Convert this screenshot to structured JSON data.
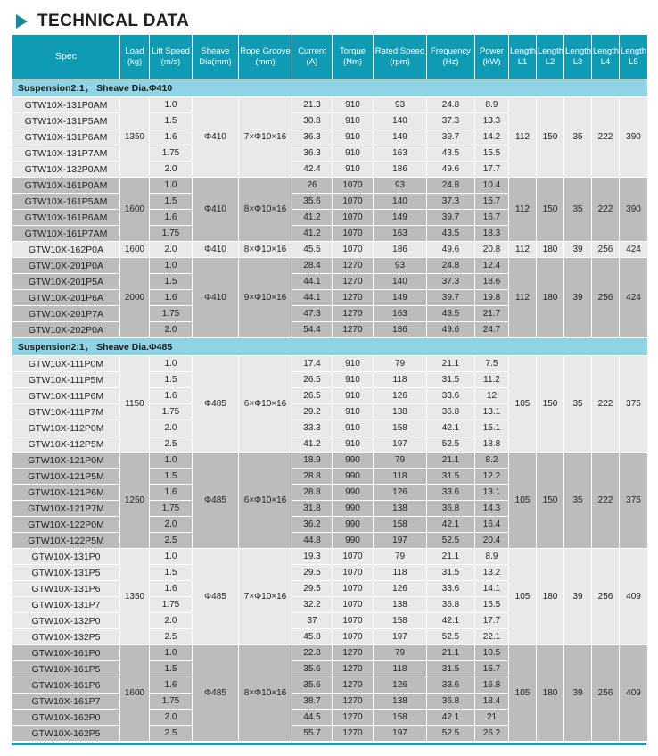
{
  "header": {
    "title": "TECHNICAL DATA",
    "arrow_icon": "triangle-right-icon",
    "accent_color": "#109bb4",
    "section_band_color": "#8ed4e5"
  },
  "table": {
    "columns": [
      {
        "label": "Spec",
        "unit": ""
      },
      {
        "label": "Load",
        "unit": "(kg)"
      },
      {
        "label": "Lift Speed",
        "unit": "(m/s)"
      },
      {
        "label": "Sheave",
        "unit": "Dia(mm)"
      },
      {
        "label": "Rope Groove",
        "unit": "(mm)"
      },
      {
        "label": "Current",
        "unit": "(A)"
      },
      {
        "label": "Torque",
        "unit": "(Nm)"
      },
      {
        "label": "Rated Speed",
        "unit": "(rpm)"
      },
      {
        "label": "Frequency",
        "unit": "(Hz)"
      },
      {
        "label": "Power",
        "unit": "(kW)"
      },
      {
        "label": "Length",
        "unit": "L1"
      },
      {
        "label": "Length",
        "unit": "L2"
      },
      {
        "label": "Length",
        "unit": "L3"
      },
      {
        "label": "Length",
        "unit": "L4"
      },
      {
        "label": "Length",
        "unit": "L5"
      }
    ],
    "sections": [
      {
        "title": "Suspension2:1， Sheave Dia.Φ410",
        "groups": [
          {
            "shade": "light",
            "load": "1350",
            "sheave_dia": "Φ410",
            "rope_groove": "7×Φ10×16",
            "l1": "112",
            "l2": "150",
            "l3": "35",
            "l4": "222",
            "l5": "390",
            "rows": [
              {
                "spec": "GTW10X-131P0AM",
                "speed": "1.0",
                "current": "21.3",
                "torque": "910",
                "rated_speed": "93",
                "frequency": "24.8",
                "power": "8.9"
              },
              {
                "spec": "GTW10X-131P5AM",
                "speed": "1.5",
                "current": "30.8",
                "torque": "910",
                "rated_speed": "140",
                "frequency": "37.3",
                "power": "13.3"
              },
              {
                "spec": "GTW10X-131P6AM",
                "speed": "1.6",
                "current": "36.3",
                "torque": "910",
                "rated_speed": "149",
                "frequency": "39.7",
                "power": "14.2"
              },
              {
                "spec": "GTW10X-131P7AM",
                "speed": "1.75",
                "current": "36.3",
                "torque": "910",
                "rated_speed": "163",
                "frequency": "43.5",
                "power": "15.5"
              },
              {
                "spec": "GTW10X-132P0AM",
                "speed": "2.0",
                "current": "42.4",
                "torque": "910",
                "rated_speed": "186",
                "frequency": "49.6",
                "power": "17.7"
              }
            ]
          },
          {
            "shade": "dark",
            "load": "1600",
            "sheave_dia": "Φ410",
            "rope_groove": "8×Φ10×16",
            "l1": "112",
            "l2": "150",
            "l3": "35",
            "l4": "222",
            "l5": "390",
            "rows": [
              {
                "spec": "GTW10X-161P0AM",
                "speed": "1.0",
                "current": "26",
                "torque": "1070",
                "rated_speed": "93",
                "frequency": "24.8",
                "power": "10.4"
              },
              {
                "spec": "GTW10X-161P5AM",
                "speed": "1.5",
                "current": "35.6",
                "torque": "1070",
                "rated_speed": "140",
                "frequency": "37.3",
                "power": "15.7"
              },
              {
                "spec": "GTW10X-161P6AM",
                "speed": "1.6",
                "current": "41.2",
                "torque": "1070",
                "rated_speed": "149",
                "frequency": "39.7",
                "power": "16.7"
              },
              {
                "spec": "GTW10X-161P7AM",
                "speed": "1.75",
                "current": "41.2",
                "torque": "1070",
                "rated_speed": "163",
                "frequency": "43.5",
                "power": "18.3"
              }
            ]
          },
          {
            "shade": "light",
            "load": "1600",
            "sheave_dia": "Φ410",
            "rope_groove": "8×Φ10×16",
            "l1": "112",
            "l2": "180",
            "l3": "39",
            "l4": "256",
            "l5": "424",
            "rows": [
              {
                "spec": "GTW10X-162P0A",
                "speed": "2.0",
                "current": "45.5",
                "torque": "1070",
                "rated_speed": "186",
                "frequency": "49.6",
                "power": "20.8"
              }
            ]
          },
          {
            "shade": "dark",
            "load": "2000",
            "sheave_dia": "Φ410",
            "rope_groove": "9×Φ10×16",
            "l1": "112",
            "l2": "180",
            "l3": "39",
            "l4": "256",
            "l5": "424",
            "rows": [
              {
                "spec": "GTW10X-201P0A",
                "speed": "1.0",
                "current": "28.4",
                "torque": "1270",
                "rated_speed": "93",
                "frequency": "24.8",
                "power": "12.4"
              },
              {
                "spec": "GTW10X-201P5A",
                "speed": "1.5",
                "current": "44.1",
                "torque": "1270",
                "rated_speed": "140",
                "frequency": "37.3",
                "power": "18.6"
              },
              {
                "spec": "GTW10X-201P6A",
                "speed": "1.6",
                "current": "44.1",
                "torque": "1270",
                "rated_speed": "149",
                "frequency": "39.7",
                "power": "19.8"
              },
              {
                "spec": "GTW10X-201P7A",
                "speed": "1.75",
                "current": "47.3",
                "torque": "1270",
                "rated_speed": "163",
                "frequency": "43.5",
                "power": "21.7"
              },
              {
                "spec": "GTW10X-202P0A",
                "speed": "2.0",
                "current": "54.4",
                "torque": "1270",
                "rated_speed": "186",
                "frequency": "49.6",
                "power": "24.7"
              }
            ]
          }
        ]
      },
      {
        "title": "Suspension2:1， Sheave Dia.Φ485",
        "groups": [
          {
            "shade": "light",
            "load": "1150",
            "sheave_dia": "Φ485",
            "rope_groove": "6×Φ10×16",
            "l1": "105",
            "l2": "150",
            "l3": "35",
            "l4": "222",
            "l5": "375",
            "rows": [
              {
                "spec": "GTW10X-111P0M",
                "speed": "1.0",
                "current": "17.4",
                "torque": "910",
                "rated_speed": "79",
                "frequency": "21.1",
                "power": "7.5"
              },
              {
                "spec": "GTW10X-111P5M",
                "speed": "1.5",
                "current": "26.5",
                "torque": "910",
                "rated_speed": "118",
                "frequency": "31.5",
                "power": "11.2"
              },
              {
                "spec": "GTW10X-111P6M",
                "speed": "1.6",
                "current": "26.5",
                "torque": "910",
                "rated_speed": "126",
                "frequency": "33.6",
                "power": "12"
              },
              {
                "spec": "GTW10X-111P7M",
                "speed": "1.75",
                "current": "29.2",
                "torque": "910",
                "rated_speed": "138",
                "frequency": "36.8",
                "power": "13.1"
              },
              {
                "spec": "GTW10X-112P0M",
                "speed": "2.0",
                "current": "33.3",
                "torque": "910",
                "rated_speed": "158",
                "frequency": "42.1",
                "power": "15.1"
              },
              {
                "spec": "GTW10X-112P5M",
                "speed": "2.5",
                "current": "41.2",
                "torque": "910",
                "rated_speed": "197",
                "frequency": "52.5",
                "power": "18.8"
              }
            ]
          },
          {
            "shade": "dark",
            "load": "1250",
            "sheave_dia": "Φ485",
            "rope_groove": "6×Φ10×16",
            "l1": "105",
            "l2": "150",
            "l3": "35",
            "l4": "222",
            "l5": "375",
            "rows": [
              {
                "spec": "GTW10X-121P0M",
                "speed": "1.0",
                "current": "18.9",
                "torque": "990",
                "rated_speed": "79",
                "frequency": "21.1",
                "power": "8.2"
              },
              {
                "spec": "GTW10X-121P5M",
                "speed": "1.5",
                "current": "28.8",
                "torque": "990",
                "rated_speed": "118",
                "frequency": "31.5",
                "power": "12.2"
              },
              {
                "spec": "GTW10X-121P6M",
                "speed": "1.6",
                "current": "28.8",
                "torque": "990",
                "rated_speed": "126",
                "frequency": "33.6",
                "power": "13.1"
              },
              {
                "spec": "GTW10X-121P7M",
                "speed": "1.75",
                "current": "31.8",
                "torque": "990",
                "rated_speed": "138",
                "frequency": "36.8",
                "power": "14.3"
              },
              {
                "spec": "GTW10X-122P0M",
                "speed": "2.0",
                "current": "36.2",
                "torque": "990",
                "rated_speed": "158",
                "frequency": "42.1",
                "power": "16.4"
              },
              {
                "spec": "GTW10X-122P5M",
                "speed": "2.5",
                "current": "44.8",
                "torque": "990",
                "rated_speed": "197",
                "frequency": "52.5",
                "power": "20.4"
              }
            ]
          },
          {
            "shade": "light",
            "load": "1350",
            "sheave_dia": "Φ485",
            "rope_groove": "7×Φ10×16",
            "l1": "105",
            "l2": "180",
            "l3": "39",
            "l4": "256",
            "l5": "409",
            "rows": [
              {
                "spec": "GTW10X-131P0",
                "speed": "1.0",
                "current": "19.3",
                "torque": "1070",
                "rated_speed": "79",
                "frequency": "21.1",
                "power": "8.9"
              },
              {
                "spec": "GTW10X-131P5",
                "speed": "1.5",
                "current": "29.5",
                "torque": "1070",
                "rated_speed": "118",
                "frequency": "31.5",
                "power": "13.2"
              },
              {
                "spec": "GTW10X-131P6",
                "speed": "1.6",
                "current": "29.5",
                "torque": "1070",
                "rated_speed": "126",
                "frequency": "33.6",
                "power": "14.1"
              },
              {
                "spec": "GTW10X-131P7",
                "speed": "1.75",
                "current": "32.2",
                "torque": "1070",
                "rated_speed": "138",
                "frequency": "36.8",
                "power": "15.5"
              },
              {
                "spec": "GTW10X-132P0",
                "speed": "2.0",
                "current": "37",
                "torque": "1070",
                "rated_speed": "158",
                "frequency": "42.1",
                "power": "17.7"
              },
              {
                "spec": "GTW10X-132P5",
                "speed": "2.5",
                "current": "45.8",
                "torque": "1070",
                "rated_speed": "197",
                "frequency": "52.5",
                "power": "22.1"
              }
            ]
          },
          {
            "shade": "dark",
            "load": "1600",
            "sheave_dia": "Φ485",
            "rope_groove": "8×Φ10×16",
            "l1": "105",
            "l2": "180",
            "l3": "39",
            "l4": "256",
            "l5": "409",
            "rows": [
              {
                "spec": "GTW10X-161P0",
                "speed": "1.0",
                "current": "22.8",
                "torque": "1270",
                "rated_speed": "79",
                "frequency": "21.1",
                "power": "10.5"
              },
              {
                "spec": "GTW10X-161P5",
                "speed": "1.5",
                "current": "35.6",
                "torque": "1270",
                "rated_speed": "118",
                "frequency": "31.5",
                "power": "15.7"
              },
              {
                "spec": "GTW10X-161P6",
                "speed": "1.6",
                "current": "35.6",
                "torque": "1270",
                "rated_speed": "126",
                "frequency": "33.6",
                "power": "16.8"
              },
              {
                "spec": "GTW10X-161P7",
                "speed": "1.75",
                "current": "38.7",
                "torque": "1270",
                "rated_speed": "138",
                "frequency": "36.8",
                "power": "18.4"
              },
              {
                "spec": "GTW10X-162P0",
                "speed": "2.0",
                "current": "44.5",
                "torque": "1270",
                "rated_speed": "158",
                "frequency": "42.1",
                "power": "21"
              },
              {
                "spec": "GTW10X-162P5",
                "speed": "2.5",
                "current": "55.7",
                "torque": "1270",
                "rated_speed": "197",
                "frequency": "52.5",
                "power": "26.2"
              }
            ]
          }
        ]
      }
    ]
  }
}
